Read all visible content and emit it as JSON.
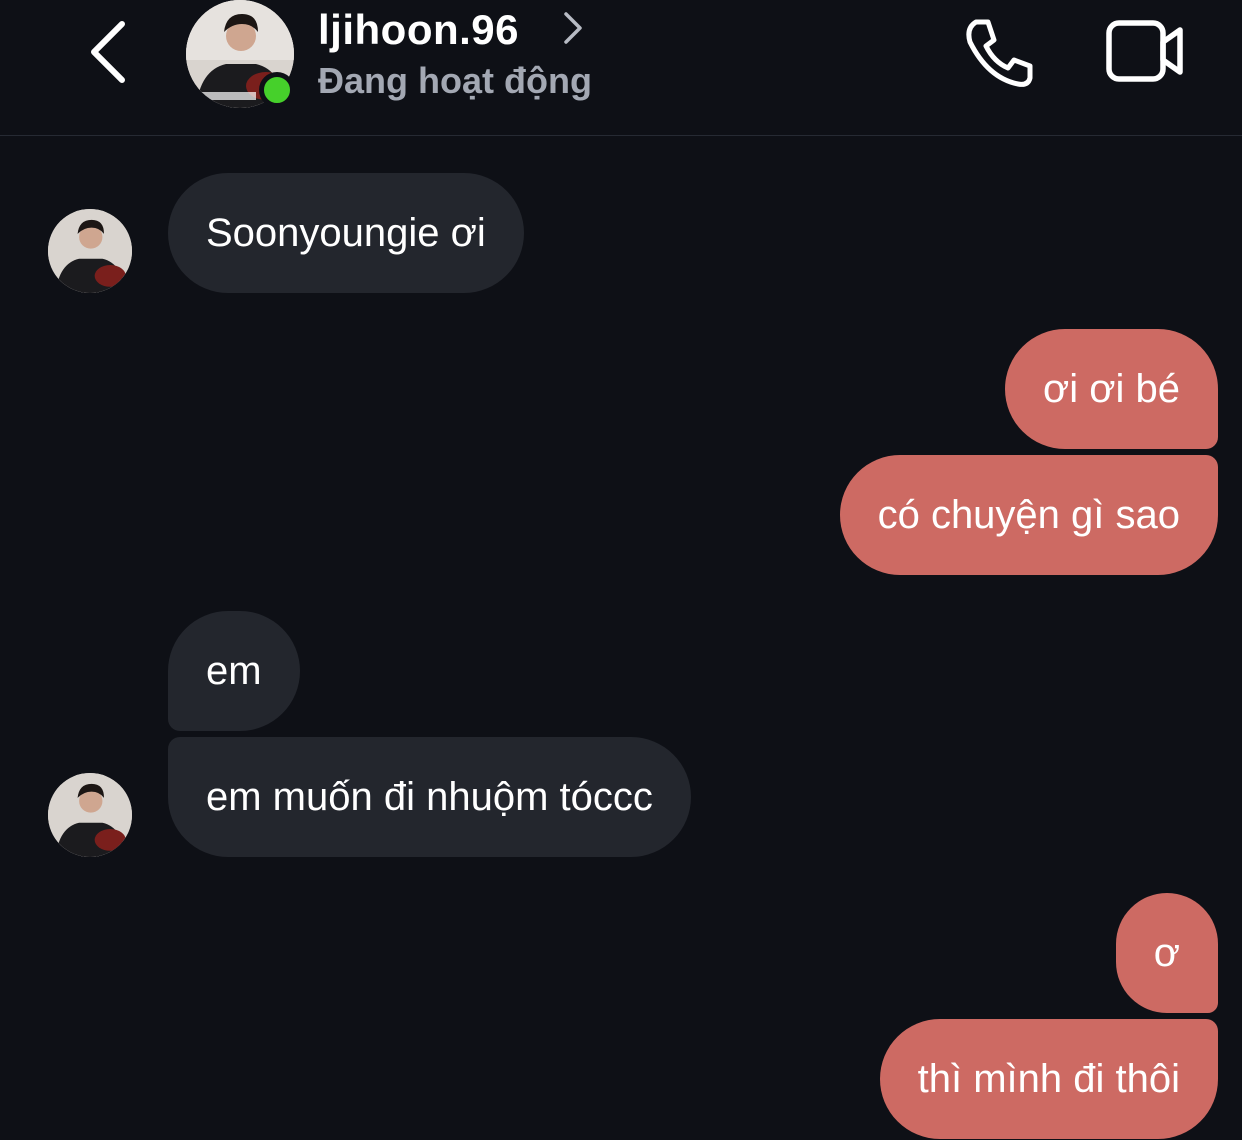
{
  "header": {
    "username": "ljihoon.96",
    "status": "Đang hoạt động",
    "icons": {
      "back": "chevron-left-icon",
      "profile": "chevron-right-icon",
      "call": "phone-icon",
      "video": "video-camera-icon"
    }
  },
  "colors": {
    "background": "#0e1016",
    "incoming_bubble": "#23262d",
    "outgoing_bubble": "#cd6a63",
    "online": "#46d02b",
    "status_text": "#a3a8b3"
  },
  "messages": [
    {
      "direction": "incoming",
      "text": "Soonyoungie ơi"
    },
    {
      "direction": "outgoing",
      "text": "ơi ơi bé"
    },
    {
      "direction": "outgoing",
      "text": "có chuyện gì sao"
    },
    {
      "direction": "incoming",
      "text": "em"
    },
    {
      "direction": "incoming",
      "text": "em muốn đi nhuộm tóccc"
    },
    {
      "direction": "outgoing",
      "text": "ơ"
    },
    {
      "direction": "outgoing",
      "text": "thì mình đi thôi"
    }
  ]
}
